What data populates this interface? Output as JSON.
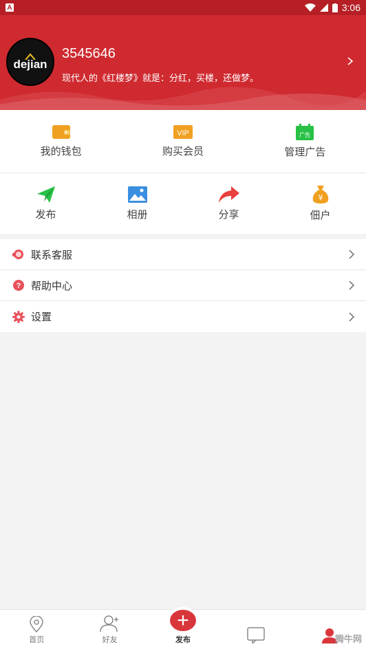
{
  "status_bar": {
    "time": "3:06"
  },
  "profile": {
    "logo_text": "dejian",
    "username": "3545646",
    "motto": "现代人的《红楼梦》就是：分红，买楼，还做梦。"
  },
  "quick_items": [
    {
      "label": "我的钱包",
      "icon": "wallet-icon"
    },
    {
      "label": "购买会员",
      "icon": "vip-icon",
      "badge": "VIP"
    },
    {
      "label": "管理广告",
      "icon": "ad-calendar-icon",
      "badge": "广告"
    }
  ],
  "actions": [
    {
      "label": "发布",
      "icon": "send-icon"
    },
    {
      "label": "相册",
      "icon": "photo-icon"
    },
    {
      "label": "分享",
      "icon": "share-icon"
    },
    {
      "label": "佃户",
      "icon": "money-bag-icon"
    }
  ],
  "menu": [
    {
      "label": "联系客服",
      "icon": "customer-service-icon"
    },
    {
      "label": "帮助中心",
      "icon": "help-icon"
    },
    {
      "label": "设置",
      "icon": "settings-icon"
    }
  ],
  "bottom_nav": [
    {
      "label": "首页",
      "icon": "location-icon"
    },
    {
      "label": "好友",
      "icon": "friends-icon"
    },
    {
      "label": "发布",
      "icon": "plus-icon"
    },
    {
      "label": "",
      "icon": "message-icon"
    },
    {
      "label": "",
      "icon": "profile-icon"
    }
  ],
  "watermark": "腾牛网",
  "colors": {
    "primary_red": "#cf2a30",
    "status_red": "#b51f25",
    "green": "#27c146",
    "blue": "#3b8fe0",
    "orange": "#f0a020"
  }
}
